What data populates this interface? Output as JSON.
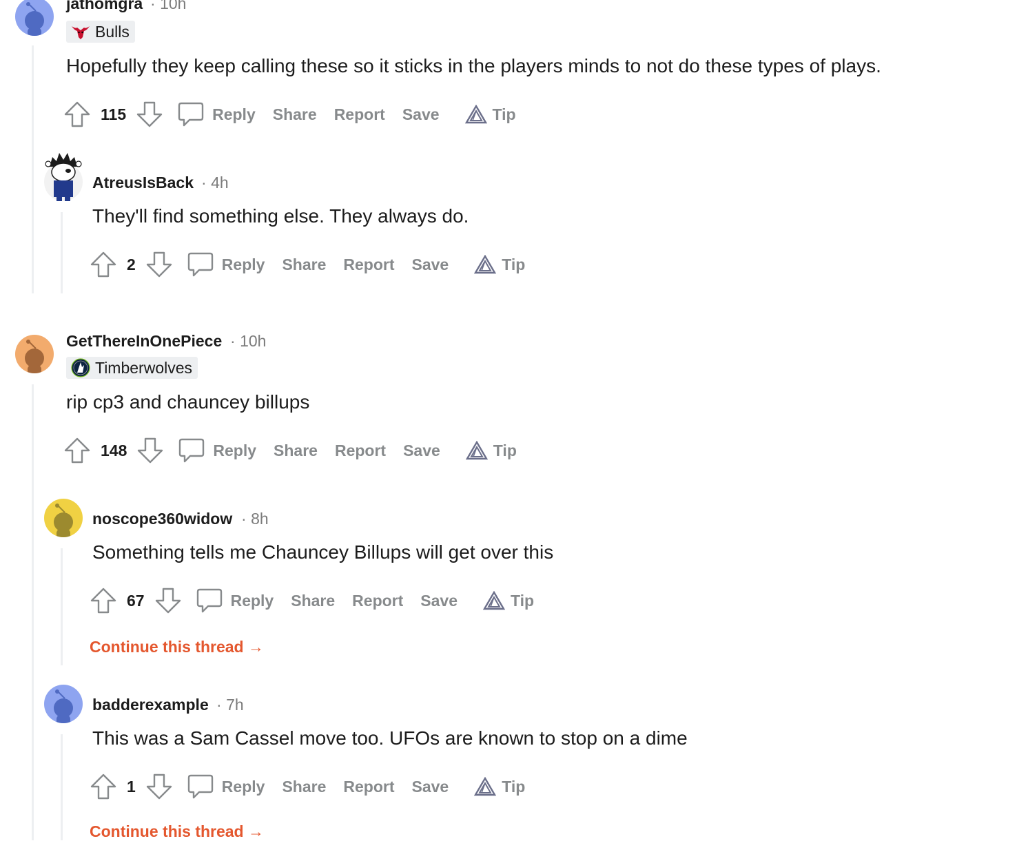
{
  "colors": {
    "accent_orange": "#e4572e",
    "muted": "#878a8c",
    "thread_line": "#edeff1",
    "flair_bg": "#edeff1"
  },
  "comments": [
    {
      "username": "jathomgra",
      "time": "10h",
      "flair": "Bulls",
      "flair_icon": "bulls-logo-icon",
      "body": "Hopefully they keep calling these so it sticks in the players minds to not do these types of plays.",
      "votes": "115",
      "avatar_color": "#8ea4f0"
    },
    {
      "username": "AtreusIsBack",
      "time": "4h",
      "body": "They'll find something else. They always do.",
      "votes": "2",
      "avatar": "custom-snoo-avatar"
    },
    {
      "username": "GetThereInOnePiece",
      "time": "10h",
      "flair": "Timberwolves",
      "flair_icon": "timberwolves-logo-icon",
      "body": "rip cp3 and chauncey billups",
      "votes": "148",
      "avatar_color": "#f2ab6d"
    },
    {
      "username": "noscope360widow",
      "time": "8h",
      "body": "Something tells me Chauncey Billups will get over this",
      "votes": "67",
      "avatar_color": "#f0d143"
    },
    {
      "username": "badderexample",
      "time": "7h",
      "body": "This was a Sam Cassel move too. UFOs are known to stop on a dime",
      "votes": "1",
      "avatar_color": "#8ea4f0"
    }
  ],
  "actions": {
    "reply": "Reply",
    "share": "Share",
    "report": "Report",
    "save": "Save",
    "tip": "Tip"
  },
  "continue_label": "Continue this thread →",
  "sep": "·"
}
